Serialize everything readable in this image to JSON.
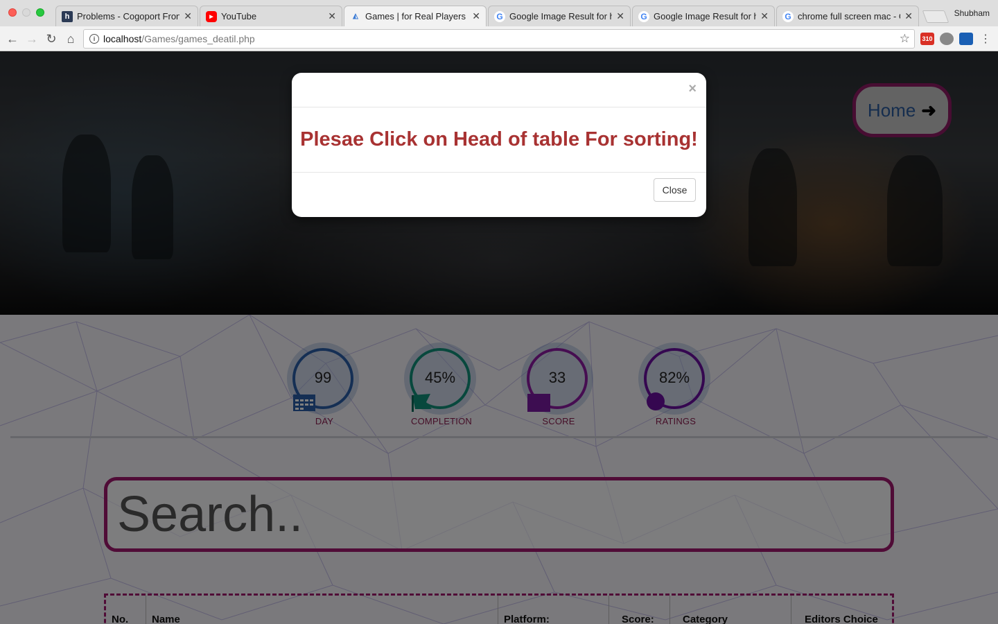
{
  "browser": {
    "tabs": [
      {
        "title": "Problems - Cogoport Front",
        "favicon": "h-icon"
      },
      {
        "title": "YouTube",
        "favicon": "youtube-icon"
      },
      {
        "title": "Games | for Real Players",
        "favicon": "game-icon",
        "active": true
      },
      {
        "title": "Google Image Result for htt",
        "favicon": "google-icon"
      },
      {
        "title": "Google Image Result for htt",
        "favicon": "google-icon"
      },
      {
        "title": "chrome full screen mac - G",
        "favicon": "google-icon"
      }
    ],
    "profile": "Shubham",
    "url_host": "localhost",
    "url_path": "/Games/games_deatil.php",
    "extension_badge": "310"
  },
  "hero": {
    "home_label": "Home"
  },
  "stats": [
    {
      "value": "99",
      "label": "DAY",
      "color": "#2a5fa8"
    },
    {
      "value": "45%",
      "label": "COMPLETION",
      "color": "#11907a"
    },
    {
      "value": "33",
      "label": "SCORE",
      "color": "#8d1aa3"
    },
    {
      "value": "82%",
      "label": "RATINGS",
      "color": "#6a0fa0"
    }
  ],
  "search": {
    "placeholder": "Search.."
  },
  "table": {
    "headers": [
      "No.",
      "Name",
      "Platform:",
      "Score:",
      "Category",
      "Editors Choice"
    ]
  },
  "modal": {
    "message": "Plesae Click on Head of table For sorting!",
    "close_x": "×",
    "close_label": "Close"
  },
  "colors": {
    "accent": "#a0186e",
    "message": "#a83232"
  }
}
